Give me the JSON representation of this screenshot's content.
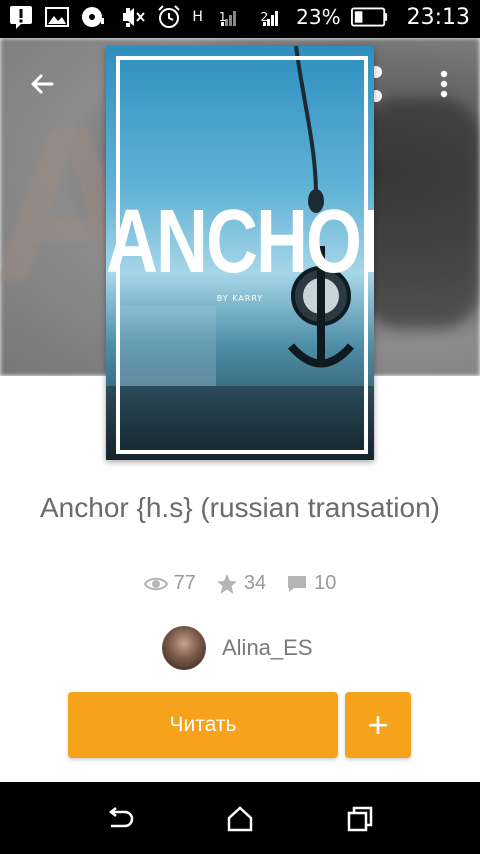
{
  "status_bar": {
    "battery_percent": "23%",
    "time": "23:13",
    "sim1_label": "1",
    "sim2_label": "2",
    "network_type": "H"
  },
  "cover": {
    "title": "ANCHOR",
    "byline": "BY KARRY"
  },
  "book": {
    "title": "Anchor {h.s} (russian transation)",
    "views": "77",
    "votes": "34",
    "comments": "10"
  },
  "author": {
    "name": "Alina_ES"
  },
  "actions": {
    "read_label": "Читать",
    "add_label": "+"
  },
  "colors": {
    "accent": "#f6a21b",
    "text_muted": "#9a9a9a"
  }
}
